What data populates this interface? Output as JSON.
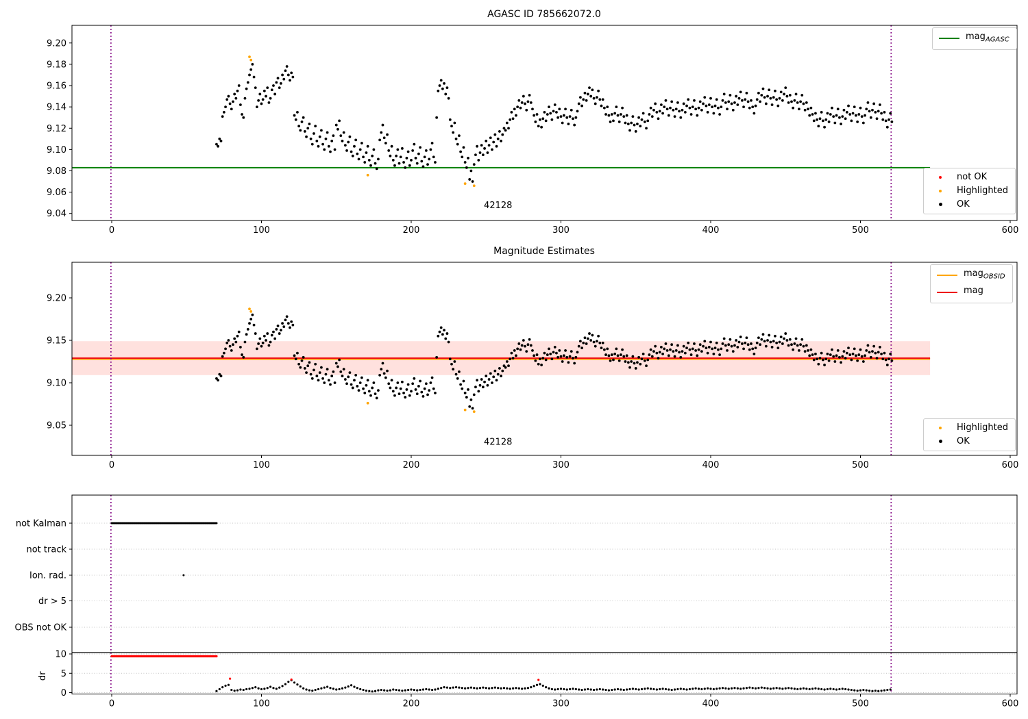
{
  "colors": {
    "ok": "#000000",
    "highlighted": "#ffa500",
    "not_ok": "#ff0000",
    "mag_agasc_line": "#008000",
    "mag_line": "#ee1111",
    "mag_obsid_line": "#ffa500",
    "band_fill": "rgba(255,40,20,0.14)",
    "vline": "#800080",
    "grid": "#c3c3c3",
    "threshold_line": "#000000"
  },
  "chart_data": [
    {
      "type": "scatter",
      "title": "AGASC ID 785662072.0",
      "xlim": [
        -26.5,
        604.6
      ],
      "ylim": [
        9.0334,
        9.2165
      ],
      "xticks": [
        0,
        100,
        200,
        300,
        400,
        500,
        600
      ],
      "yticks": [
        9.04,
        9.06,
        9.08,
        9.1,
        9.12,
        9.14,
        9.16,
        9.18,
        9.2
      ],
      "hline": {
        "y": 9.083,
        "x_start": -26.5,
        "x_end": 546.5
      },
      "vlines": [
        -0.5,
        520.5
      ],
      "annotation": {
        "text": "42128",
        "x": 258,
        "y": 9.045
      },
      "legend_line": [
        {
          "label_main": "mag",
          "label_sub": "AGASC"
        }
      ],
      "legend_points": [
        {
          "label": "not OK"
        },
        {
          "label": "Highlighted"
        },
        {
          "label": "OK"
        }
      ],
      "series": {
        "not_ok": [],
        "highlighted": [
          [
            92,
            9.187
          ],
          [
            93,
            9.184
          ],
          [
            171,
            9.076
          ],
          [
            236,
            9.068
          ],
          [
            242,
            9.066
          ]
        ],
        "ok_segments": [
          {
            "x_start": 70,
            "step": 1,
            "y": [
              9.105,
              9.103,
              9.11,
              9.108,
              9.131,
              9.135,
              9.14,
              9.147,
              9.15,
              9.143,
              9.138,
              9.145,
              9.152,
              9.148,
              9.155,
              9.16,
              9.142,
              9.133,
              9.13,
              9.148,
              9.157,
              9.163,
              9.17,
              9.175,
              9.18,
              9.168,
              9.158
            ]
          },
          {
            "x_start": 97,
            "step": 1,
            "y": [
              9.14,
              9.146,
              9.152,
              9.143,
              9.147,
              9.155,
              9.15,
              9.158,
              9.144,
              9.148,
              9.156,
              9.16,
              9.152,
              9.163,
              9.167,
              9.158,
              9.162,
              9.17,
              9.166,
              9.174,
              9.178,
              9.17,
              9.165,
              9.172,
              9.168
            ]
          },
          {
            "x_start": 122,
            "step": 1,
            "y": [
              9.132,
              9.128,
              9.135,
              9.122,
              9.118,
              9.126,
              9.13,
              9.117,
              9.112,
              9.12,
              9.124,
              9.11,
              9.105,
              9.115,
              9.122,
              9.108,
              9.103,
              9.112,
              9.118,
              9.105,
              9.1,
              9.11,
              9.116,
              9.103,
              9.098,
              9.108,
              9.113,
              9.1,
              9.123,
              9.119,
              9.127,
              9.113,
              9.108,
              9.116,
              9.104,
              9.099,
              9.107,
              9.112,
              9.098,
              9.094,
              9.103,
              9.109,
              9.096,
              9.091,
              9.1,
              9.106
            ]
          },
          {
            "x_start": 168,
            "step": 1,
            "y": [
              9.093,
              9.088,
              9.097,
              9.103,
              9.09,
              9.085,
              9.094,
              9.1,
              9.087,
              9.082,
              9.091,
              9.109,
              9.116,
              9.123,
              9.111,
              9.106,
              9.114,
              9.099,
              9.094,
              9.103,
              9.09,
              9.085,
              9.094,
              9.1,
              9.087,
              9.093,
              9.101,
              9.088,
              9.083,
              9.092,
              9.098,
              9.085,
              9.09,
              9.099,
              9.105,
              9.092,
              9.087,
              9.096,
              9.102,
              9.089,
              9.084,
              9.093,
              9.099,
              9.086,
              9.091,
              9.1,
              9.106,
              9.093,
              9.088
            ]
          },
          {
            "x_start": 217,
            "step": 1,
            "y": [
              9.13,
              9.155,
              9.16,
              9.165,
              9.157,
              9.162,
              9.152,
              9.158,
              9.148
            ]
          },
          {
            "x_start": 226,
            "step": 1,
            "y": [
              9.128,
              9.122,
              9.116,
              9.125,
              9.11,
              9.105,
              9.113,
              9.098,
              9.093,
              9.102,
              9.088,
              9.083,
              9.092,
              9.072,
              9.08,
              9.07,
              9.086,
              9.095,
              9.103,
              9.09,
              9.097,
              9.104
            ]
          },
          {
            "x_start": 248,
            "step": 1,
            "y": [
              9.095,
              9.101,
              9.108,
              9.097,
              9.104,
              9.111,
              9.1,
              9.107,
              9.114,
              9.103,
              9.11,
              9.117,
              9.108,
              9.114,
              9.12
            ]
          },
          {
            "x_start": 263,
            "step": 1,
            "y": [
              9.118,
              9.125,
              9.12,
              9.128,
              9.135,
              9.129,
              9.138,
              9.132,
              9.14,
              9.146,
              9.139,
              9.144,
              9.15,
              9.143,
              9.137,
              9.145,
              9.151,
              9.144,
              9.138,
              9.132,
              9.126,
              9.133,
              9.122,
              9.128,
              9.121,
              9.129,
              9.135,
              9.127,
              9.133,
              9.14,
              9.134,
              9.128,
              9.136,
              9.142,
              9.135,
              9.13,
              9.138,
              9.131,
              9.125,
              9.132,
              9.138,
              9.13,
              9.124,
              9.131,
              9.137,
              9.129,
              9.123,
              9.13,
              9.136,
              9.143,
              9.149,
              9.141,
              9.147,
              9.153,
              9.146,
              9.152,
              9.158,
              9.15,
              9.156,
              9.148,
              9.143,
              9.149,
              9.155,
              9.147,
              9.141,
              9.147,
              9.139,
              9.133,
              9.14,
              9.132,
              9.126,
              9.133,
              9.127,
              9.134,
              9.14,
              9.132,
              9.126,
              9.133,
              9.139,
              9.131,
              9.125,
              9.132,
              9.124,
              9.118,
              9.125,
              9.131,
              9.123,
              9.117,
              9.124,
              9.13,
              9.122,
              9.128,
              9.134,
              9.126,
              9.12,
              9.127,
              9.133,
              9.139,
              9.131,
              9.137,
              9.143,
              9.135,
              9.129,
              9.136,
              9.142,
              9.134,
              9.14,
              9.146,
              9.138,
              9.132,
              9.139,
              9.145,
              9.137,
              9.131,
              9.138,
              9.144,
              9.136,
              9.13,
              9.137,
              9.143,
              9.135,
              9.141,
              9.147,
              9.139,
              9.133,
              9.14,
              9.146,
              9.138,
              9.132,
              9.139,
              9.145,
              9.137,
              9.143,
              9.149,
              9.141,
              9.135,
              9.142,
              9.148,
              9.14,
              9.134,
              9.141,
              9.147,
              9.139,
              9.133,
              9.14,
              9.146,
              9.152,
              9.144,
              9.138,
              9.145,
              9.151,
              9.143,
              9.137,
              9.144,
              9.15,
              9.142,
              9.148,
              9.154,
              9.146,
              9.14,
              9.147,
              9.153,
              9.145,
              9.139,
              9.146,
              9.14,
              9.134,
              9.141,
              9.147,
              9.153,
              9.145,
              9.151,
              9.157,
              9.149,
              9.143,
              9.15,
              9.156,
              9.148,
              9.142,
              9.149,
              9.155,
              9.147,
              9.141,
              9.148,
              9.154,
              9.146,
              9.152,
              9.158,
              9.15,
              9.144,
              9.151,
              9.145,
              9.139,
              9.146,
              9.152,
              9.144,
              9.138,
              9.145,
              9.151,
              9.143,
              9.137,
              9.144,
              9.138,
              9.132,
              9.139,
              9.133,
              9.127,
              9.134,
              9.128,
              9.122,
              9.129,
              9.135,
              9.127,
              9.121,
              9.128,
              9.134,
              9.126,
              9.133,
              9.139,
              9.131,
              9.125,
              9.132,
              9.138,
              9.13,
              9.124,
              9.131,
              9.137,
              9.129,
              9.135,
              9.141,
              9.133,
              9.127,
              9.134,
              9.14,
              9.132,
              9.126,
              9.133,
              9.139,
              9.131,
              9.125,
              9.132,
              9.138,
              9.144,
              9.136,
              9.13,
              9.137,
              9.143,
              9.135,
              9.129,
              9.136,
              9.142,
              9.134,
              9.128,
              9.135,
              9.127,
              9.121,
              9.128,
              9.134,
              9.126
            ]
          }
        ]
      }
    },
    {
      "type": "scatter",
      "title": "Magnitude Estimates",
      "xlim": [
        -26.5,
        604.6
      ],
      "ylim": [
        9.0145,
        9.242
      ],
      "xticks": [
        0,
        100,
        200,
        300,
        400,
        500,
        600
      ],
      "yticks": [
        9.05,
        9.1,
        9.15,
        9.2
      ],
      "series_ref": 0,
      "mag_line": {
        "y": 9.129,
        "x_start": -26.5,
        "x_end": 546.5
      },
      "obsid_line": {
        "y": 9.129,
        "x_start": -26.5,
        "x_end": 546.5
      },
      "band": {
        "y1": 9.109,
        "y2": 9.149,
        "x_start": -26.5,
        "x_end": 546.5
      },
      "vlines": [
        -0.5,
        520.5
      ],
      "annotation": {
        "text": "42128",
        "x": 258,
        "y": 9.027
      },
      "legend_line": [
        {
          "label_main": "mag",
          "label_sub": "OBSID"
        },
        {
          "label_main": "mag",
          "label_sub": ""
        }
      ],
      "legend_points": [
        {
          "label": "Highlighted"
        },
        {
          "label": "OK"
        }
      ]
    },
    {
      "type": "flags_dr",
      "xlim": [
        -26.5,
        604.6
      ],
      "xticks": [
        0,
        100,
        200,
        300,
        400,
        500,
        600
      ],
      "flag_rows": [
        "not Kalman",
        "not track",
        "Ion. rad.",
        "dr > 5",
        "OBS not OK"
      ],
      "flag_runs": [
        {
          "row": 0,
          "x_start": 0,
          "x_end": 70.5,
          "step": 0.7
        }
      ],
      "flag_points": [
        {
          "row": 2,
          "x": 48
        }
      ],
      "vlines": [
        -0.5,
        520.5
      ],
      "dr": {
        "ylabel": "dr",
        "yticks": [
          0,
          5,
          10
        ],
        "threshold_y": 10.35,
        "red_run": {
          "x_start": 0,
          "x_end": 70.5,
          "step": 0.7,
          "y": 9.4
        },
        "red_points": [
          [
            79,
            3.6
          ],
          [
            120,
            3.4
          ],
          [
            285,
            3.3
          ]
        ],
        "points": {
          "x_start": 70,
          "step": 2,
          "y": [
            0.4,
            0.9,
            1.4,
            1.8,
            2.0,
            0.7,
            0.5,
            0.6,
            0.8,
            0.7,
            0.9,
            1.0,
            1.2,
            1.4,
            1.1,
            0.9,
            1.0,
            1.2,
            1.5,
            1.2,
            1.0,
            1.3,
            1.7,
            2.2,
            2.8,
            3.2,
            2.6,
            2.1,
            1.6,
            1.1,
            0.8,
            0.6,
            0.5,
            0.7,
            0.9,
            1.1,
            1.3,
            1.5,
            1.2,
            1.0,
            0.8,
            0.9,
            1.1,
            1.3,
            1.6,
            1.9,
            1.5,
            1.2,
            0.9,
            0.7,
            0.5,
            0.4,
            0.3,
            0.4,
            0.6,
            0.7,
            0.6,
            0.5,
            0.6,
            0.8,
            0.7,
            0.6,
            0.5,
            0.6,
            0.7,
            0.8,
            0.7,
            0.6,
            0.7,
            0.8,
            0.9,
            0.8,
            0.7,
            0.8,
            1.0,
            1.2,
            1.4,
            1.3,
            1.2,
            1.3,
            1.4,
            1.3,
            1.2,
            1.1,
            1.2,
            1.3,
            1.2,
            1.1,
            1.2,
            1.3,
            1.2,
            1.1,
            1.2,
            1.3,
            1.2,
            1.1,
            1.2,
            1.1,
            1.0,
            1.1,
            1.2,
            1.1,
            1.0,
            1.1,
            1.2,
            1.4,
            1.7,
            2.0,
            2.2,
            1.8,
            1.4,
            1.1,
            0.9,
            0.8,
            0.9,
            1.0,
            0.9,
            0.8,
            0.9,
            1.0,
            0.9,
            0.8,
            0.7,
            0.8,
            0.9,
            0.8,
            0.7,
            0.8,
            0.9,
            0.8,
            0.7,
            0.6,
            0.7,
            0.8,
            0.9,
            0.8,
            0.7,
            0.8,
            0.9,
            1.0,
            0.9,
            0.8,
            0.9,
            1.0,
            1.1,
            1.0,
            0.9,
            0.8,
            0.9,
            1.0,
            0.9,
            0.8,
            0.7,
            0.8,
            0.9,
            1.0,
            0.9,
            0.8,
            0.9,
            1.0,
            1.1,
            1.0,
            0.9,
            1.0,
            1.1,
            1.0,
            0.9,
            1.0,
            1.1,
            1.2,
            1.1,
            1.0,
            1.1,
            1.2,
            1.1,
            1.0,
            1.1,
            1.2,
            1.3,
            1.2,
            1.1,
            1.2,
            1.3,
            1.2,
            1.1,
            1.0,
            1.1,
            1.2,
            1.1,
            1.0,
            1.1,
            1.2,
            1.1,
            1.0,
            0.9,
            1.0,
            1.1,
            1.0,
            0.9,
            1.0,
            1.1,
            1.0,
            0.9,
            0.8,
            0.9,
            1.0,
            0.9,
            0.8,
            0.9,
            1.0,
            0.9,
            0.8,
            0.7,
            0.6,
            0.5,
            0.6,
            0.7,
            0.6,
            0.5,
            0.4,
            0.5,
            0.4,
            0.5,
            0.6,
            0.7,
            0.8
          ]
        }
      }
    }
  ]
}
